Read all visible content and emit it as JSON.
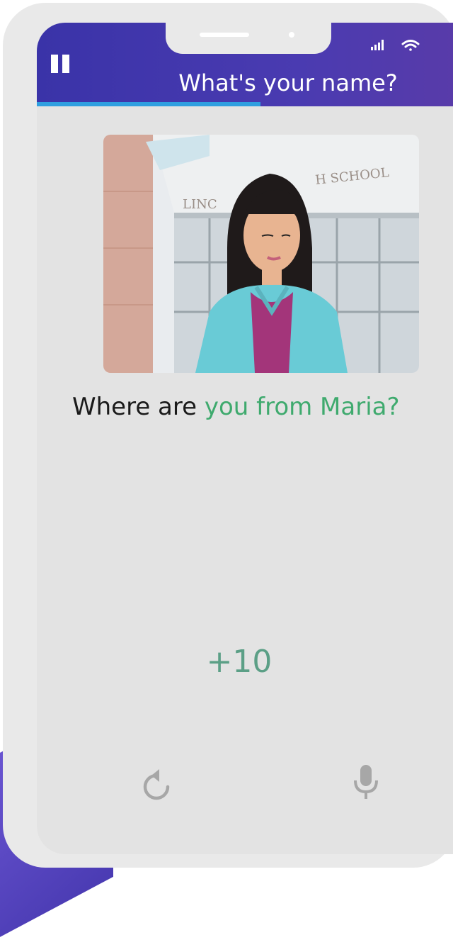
{
  "header": {
    "title": "What's your name?",
    "progress_fraction": 0.51,
    "colors": {
      "primary": "#3a33a8",
      "progress": "#2f9fe0"
    }
  },
  "status": {
    "signal_icon": "cellular-signal-icon",
    "wifi_icon": "wifi-icon"
  },
  "illustration": {
    "building_sign": "LINCOLN HIGH SCHOOL",
    "building_sign_visible_left": "LINC",
    "building_sign_visible_right": "H SCHOOL"
  },
  "question": {
    "prefix": "Where are ",
    "highlight": "you from Maria?",
    "highlight_color": "#3faa6e"
  },
  "points": "+10",
  "controls": {
    "replay_icon": "replay-icon",
    "mic_icon": "microphone-icon"
  }
}
